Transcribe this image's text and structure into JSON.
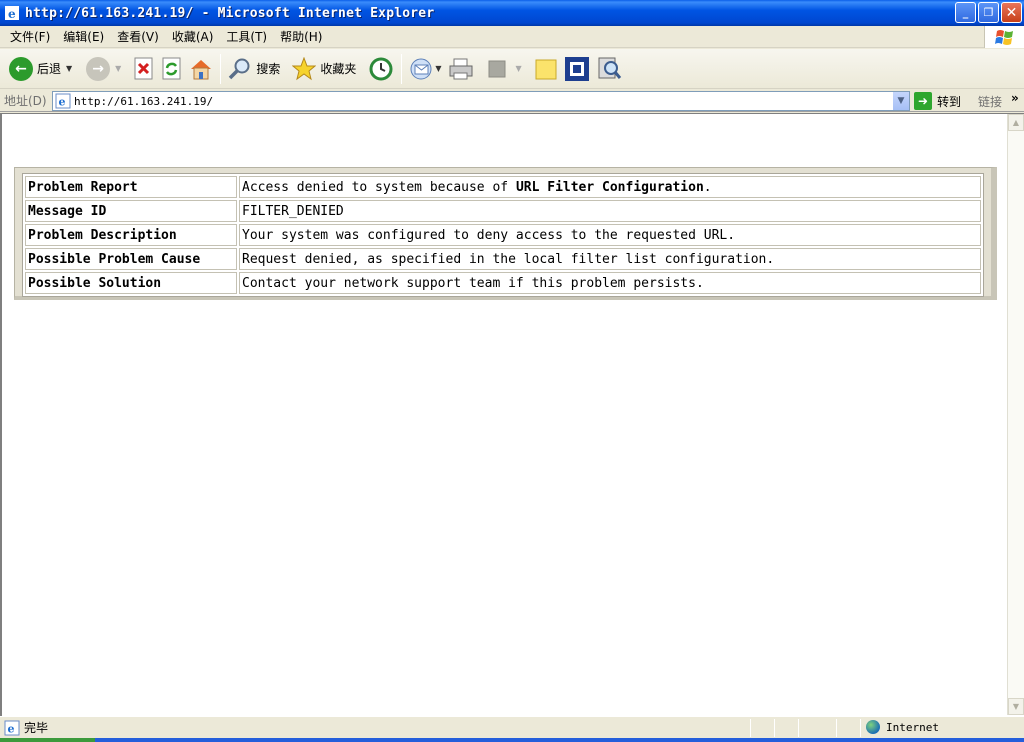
{
  "window": {
    "title": "http://61.163.241.19/ - Microsoft Internet Explorer",
    "minimize": "_",
    "maximize": "❐",
    "close": "✕"
  },
  "menu": [
    "文件(F)",
    "编辑(E)",
    "查看(V)",
    "收藏(A)",
    "工具(T)",
    "帮助(H)"
  ],
  "toolbar": {
    "back_label": "后退",
    "search_label": "搜索",
    "favorites_label": "收藏夹"
  },
  "address": {
    "label": "地址(D)",
    "url": "http://61.163.241.19/",
    "go_label": "转到",
    "links_label": "链接",
    "chevron": "»"
  },
  "report": {
    "rows": [
      {
        "key": "Problem Report",
        "value_prefix": "Access denied to system because of ",
        "value_bold": "URL Filter Configuration",
        "value_suffix": "."
      },
      {
        "key": "Message ID",
        "value": "FILTER_DENIED"
      },
      {
        "key": "Problem Description",
        "value": "Your system was configured to deny access to the requested URL."
      },
      {
        "key": "Possible Problem Cause",
        "value": "Request denied, as specified in the local filter list configuration."
      },
      {
        "key": "Possible Solution",
        "value": "Contact your network support team if this problem persists."
      }
    ]
  },
  "status": {
    "text": "完毕",
    "zone": "Internet"
  },
  "colors": {
    "titlebar": "#0054e3",
    "chrome": "#ece9d8",
    "content_bg": "#ffffff"
  }
}
